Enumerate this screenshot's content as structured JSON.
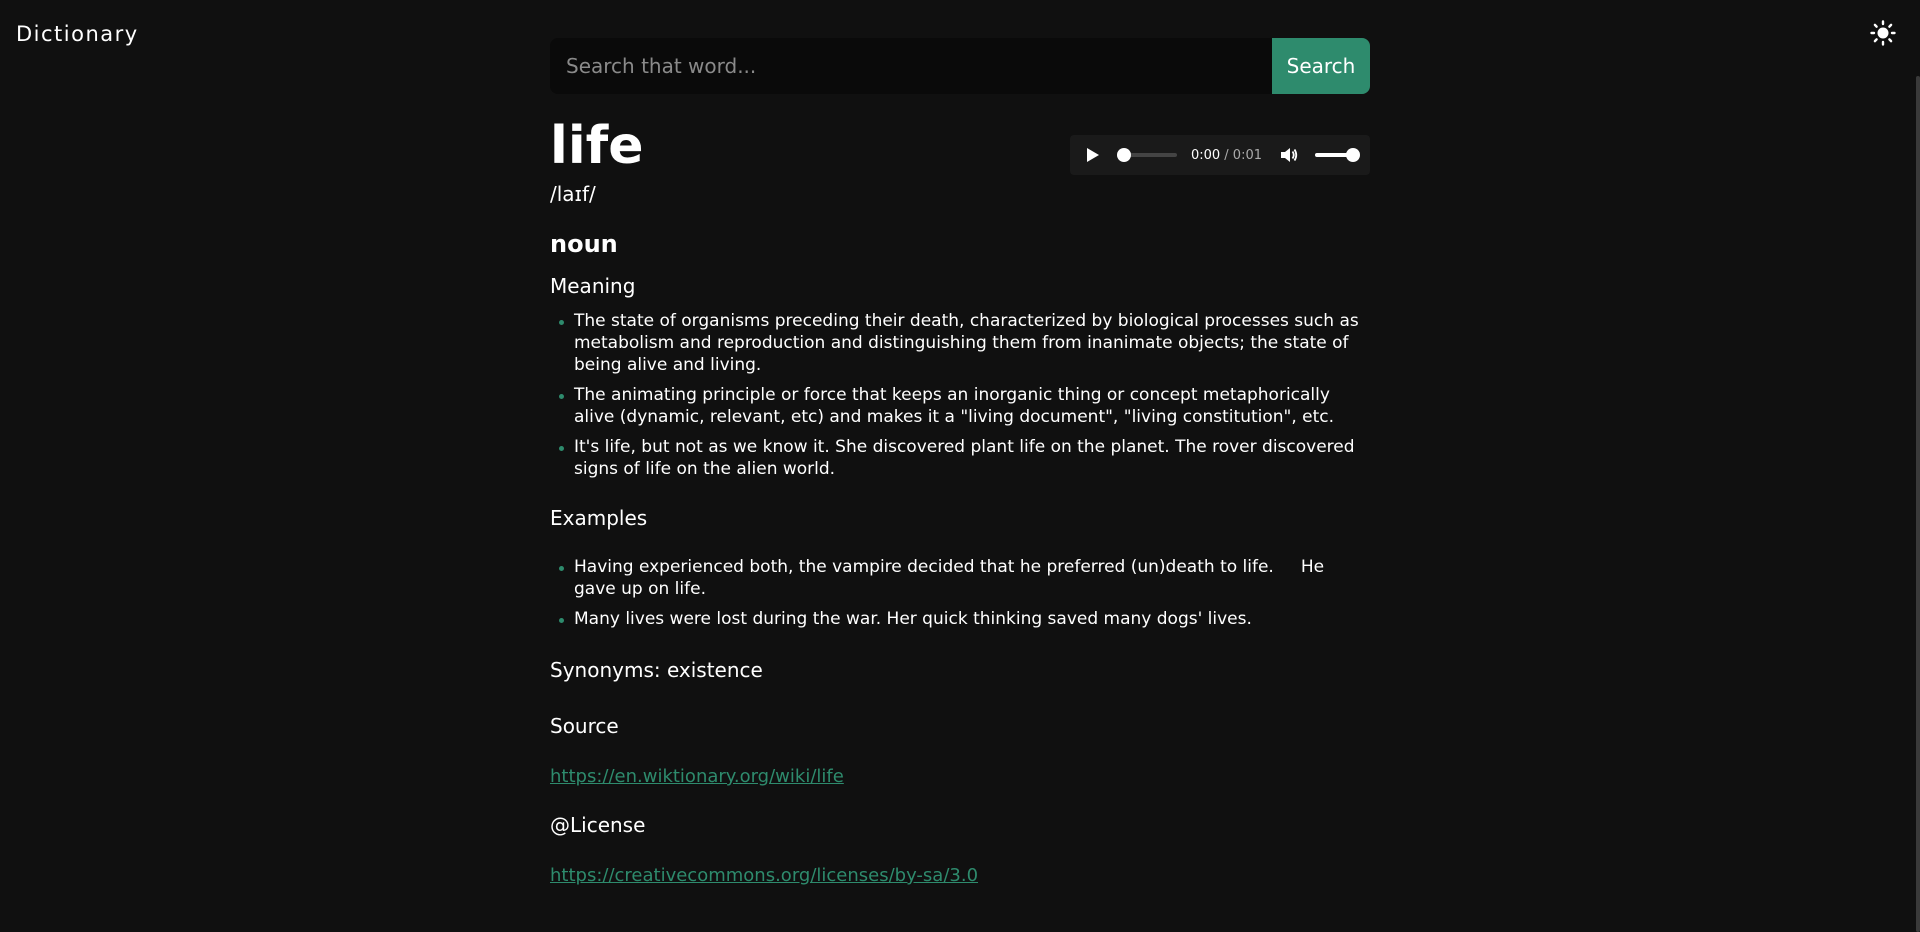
{
  "header": {
    "brand": "Dictionary"
  },
  "search": {
    "placeholder": "Search that word...",
    "value": "",
    "button_label": "Search"
  },
  "entry": {
    "word": "life",
    "phonetic": "/laɪf/",
    "audio": {
      "current_time": "0:00",
      "duration": "/ 0:01",
      "progress": 0,
      "volume": 1
    },
    "part_of_speech": "noun",
    "meaning_title": "Meaning",
    "definitions": [
      "The state of organisms preceding their death, characterized by biological processes such as metabolism and reproduction and distinguishing them from inanimate objects; the state of being alive and living.",
      "The animating principle or force that keeps an inorganic thing or concept metaphorically alive (dynamic, relevant, etc) and makes it a \"living document\", \"living constitution\", etc.",
      "It's life, but not as we know it. She discovered plant life on the planet. The rover discovered signs of life on the alien world."
    ],
    "examples_title": "Examples",
    "examples": [
      "Having experienced both, the vampire decided that he preferred (un)death to life.     He gave up on life.",
      "Many lives were lost during the war. Her quick thinking saved many dogs' lives."
    ],
    "synonyms": "Synonyms: existence",
    "source_title": "Source",
    "source_url": "https://en.wiktionary.org/wiki/life",
    "license_title": "@License",
    "license_url": "https://creativecommons.org/licenses/by-sa/3.0"
  },
  "colors": {
    "background": "#101010",
    "accent": "#2e8b6d",
    "text": "#ffffff"
  },
  "icons": {
    "theme": "sun-icon",
    "play": "play-icon",
    "mute": "volume-icon"
  }
}
